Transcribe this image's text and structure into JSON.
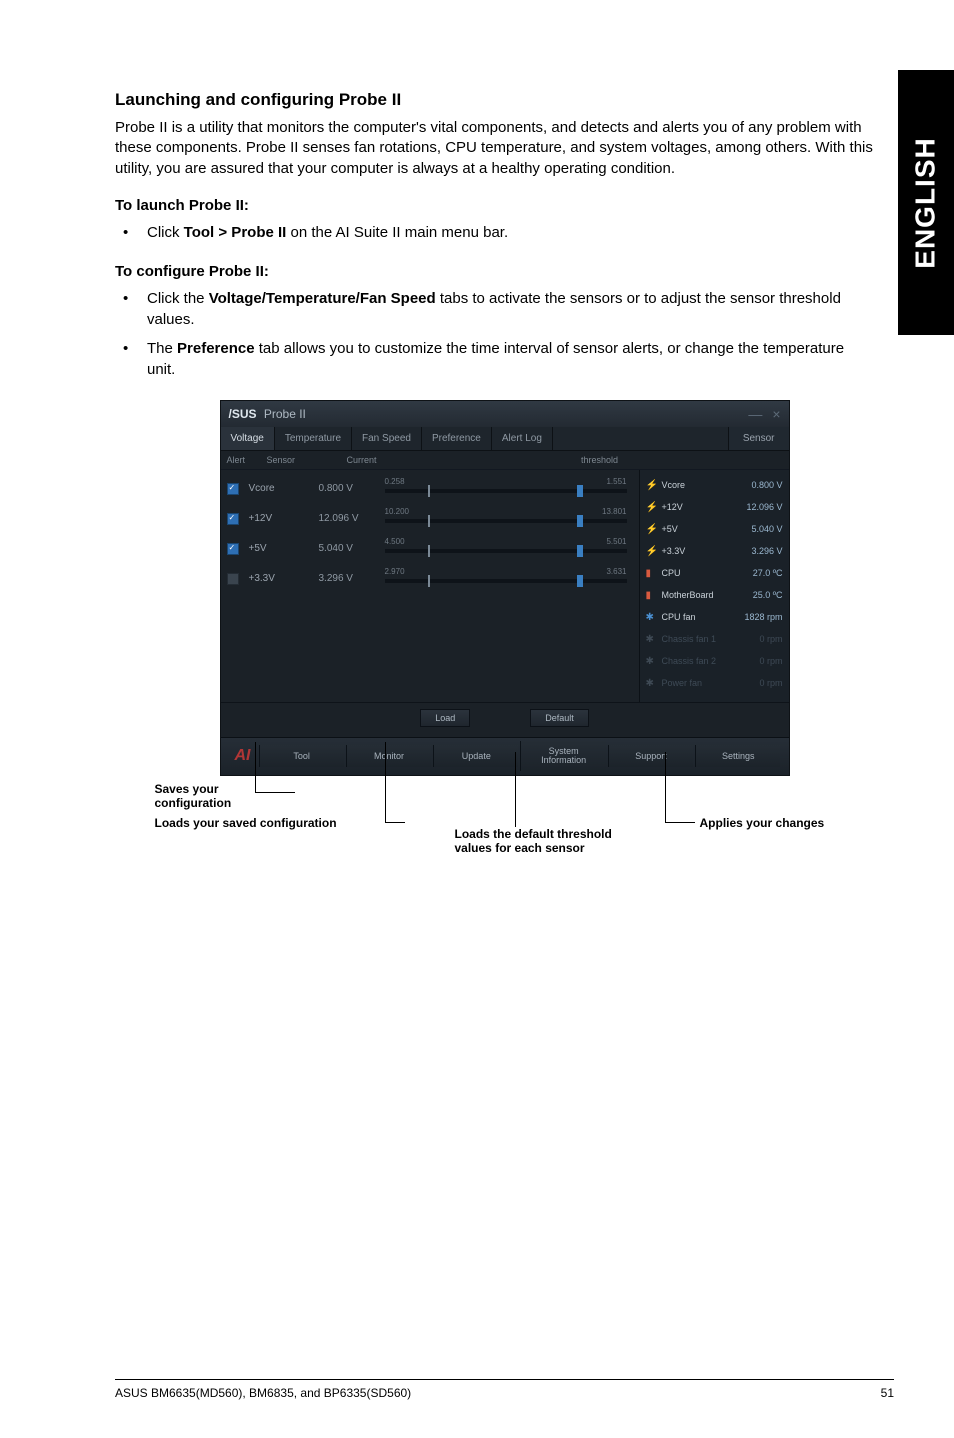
{
  "sideTab": "ENGLISH",
  "section": {
    "title": "Launching and configuring Probe II",
    "intro": "Probe II is a utility that monitors the computer's vital components, and detects and alerts you of any problem with these components. Probe II senses fan rotations, CPU temperature, and system voltages, among others. With this utility, you are assured that your computer is always at a healthy operating condition.",
    "launchHeading": "To launch Probe II:",
    "launchBullet": "Click Tool > Probe II on the AI Suite II main menu bar.",
    "configHeading": "To configure Probe II:",
    "configBullet1": "Click the Voltage/Temperature/Fan Speed tabs to activate the sensors or to adjust the sensor threshold values.",
    "configBullet2": "The Preference tab allows you to customize the time interval of sensor alerts, or change the temperature unit."
  },
  "probe": {
    "title": "Probe II",
    "brand": "/SUS",
    "tabs": {
      "voltage": "Voltage",
      "temperature": "Temperature",
      "fanspeed": "Fan Speed",
      "preference": "Preference",
      "alertlog": "Alert Log",
      "sensor": "Sensor"
    },
    "head": {
      "alert": "Alert",
      "sensor": "Sensor",
      "current": "Current",
      "threshold": "threshold"
    },
    "rows": [
      {
        "sensor": "Vcore",
        "current": "0.800 V",
        "tlow": "0.258",
        "thigh": "1.551"
      },
      {
        "sensor": "+12V",
        "current": "12.096 V",
        "tlow": "10.200",
        "thigh": "13.801"
      },
      {
        "sensor": "+5V",
        "current": "5.040 V",
        "tlow": "4.500",
        "thigh": "5.501"
      },
      {
        "sensor": "+3.3V",
        "current": "3.296 V",
        "tlow": "2.970",
        "thigh": "3.631"
      }
    ],
    "right": [
      {
        "icon": "bolt",
        "label": "Vcore",
        "val": "0.800 V"
      },
      {
        "icon": "bolt",
        "label": "+12V",
        "val": "12.096 V"
      },
      {
        "icon": "bolt",
        "label": "+5V",
        "val": "5.040 V"
      },
      {
        "icon": "bolt",
        "label": "+3.3V",
        "val": "3.296 V"
      },
      {
        "icon": "therm",
        "label": "CPU",
        "val": "27.0 ºC"
      },
      {
        "icon": "therm",
        "label": "MotherBoard",
        "val": "25.0 ºC"
      },
      {
        "icon": "fan",
        "label": "CPU fan",
        "val": "1828 rpm"
      },
      {
        "icon": "dim",
        "label": "Chassis fan 1",
        "val": "0 rpm",
        "dim": true
      },
      {
        "icon": "dim",
        "label": "Chassis fan 2",
        "val": "0 rpm",
        "dim": true
      },
      {
        "icon": "dim",
        "label": "Power fan",
        "val": "0 rpm",
        "dim": true
      }
    ],
    "mid": {
      "load": "Load",
      "default": "Default"
    },
    "bottom": {
      "tool": "Tool",
      "monitor": "Monitor",
      "update": "Update",
      "sysinfo1": "System",
      "sysinfo2": "Information",
      "support": "Support",
      "settings": "Settings"
    }
  },
  "annotations": {
    "saves": "Saves your configuration",
    "loads": "Loads your saved configuration",
    "defaultNote": "Loads the default threshold values for each sensor",
    "applies": "Applies your changes"
  },
  "footer": {
    "left": "ASUS BM6635(MD560), BM6835, and BP6335(SD560)",
    "right": "51"
  }
}
